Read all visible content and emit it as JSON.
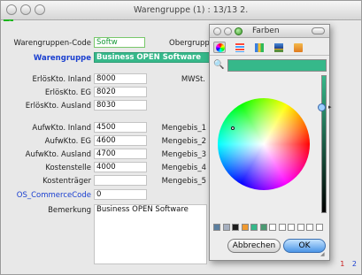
{
  "window": {
    "title": "Warengruppe (1) : 13/13 2."
  },
  "form": {
    "warengruppen_code_label": "Warengruppen-Code",
    "warengruppen_code_value": "Softw",
    "obergruppe_label": "Obergruppe",
    "warengruppe_label": "Warengruppe",
    "warengruppe_value": "Business OPEN Software",
    "erloes_inland_label": "ErlösKto. Inland",
    "erloes_inland_value": "8000",
    "mwst_label": "MWSt.",
    "erloes_eg_label": "ErlösKto. EG",
    "erloes_eg_value": "8020",
    "erloes_ausland_label": "ErlösKto. Ausland",
    "erloes_ausland_value": "8030",
    "aufw_inland_label": "AufwKto. Inland",
    "aufw_inland_value": "4500",
    "aufw_eg_label": "AufwKto. EG",
    "aufw_eg_value": "4600",
    "aufw_ausland_label": "AufwKto. Ausland",
    "aufw_ausland_value": "4700",
    "kostenstelle_label": "Kostenstelle",
    "kostenstelle_value": "4000",
    "kostentraeger_label": "Kostenträger",
    "kostentraeger_value": "",
    "os_commercecode_label": "OS_CommerceCode",
    "os_commercecode_value": "0",
    "bemerkung_label": "Bemerkung",
    "bemerkung_value": "Business OPEN Software",
    "mengebis_labels": [
      "Mengebis_1",
      "Mengebis_2",
      "Mengebis_3",
      "Mengebis_4",
      "Mengebis_5"
    ]
  },
  "pager": {
    "first": "1",
    "second": "2"
  },
  "color_panel": {
    "title": "Farben",
    "cancel_label": "Abbrechen",
    "ok_label": "OK",
    "selected_color": "#36b88a",
    "modes": [
      "color-wheel-icon",
      "sliders-icon",
      "palettes-icon",
      "image-palettes-icon",
      "crayons-icon"
    ],
    "swatches": [
      "#5b7fa0",
      "#a6b0c0",
      "#1e1e1e",
      "#f09a30",
      "#36b88a",
      "#4a9a72",
      "#ffffff",
      "#ffffff",
      "#ffffff",
      "#ffffff",
      "#ffffff",
      "#ffffff"
    ]
  },
  "colors": {
    "accent_green": "#36b88a",
    "label_blue": "#1a3fd0",
    "pager_red": "#c81b1b"
  }
}
